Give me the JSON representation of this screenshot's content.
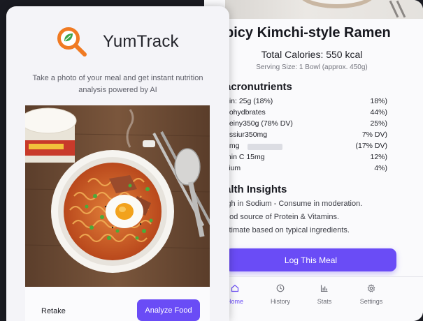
{
  "app": {
    "brand": "YumTrack",
    "tagline": "Take a photo of your meal and get instant nutrition analysis powered by AI",
    "retake_label": "Retake",
    "analyze_label": "Analyze Food",
    "accent_color": "#6a4cf6",
    "logo_color": "#f07a22",
    "leaf_color": "#3aa54a"
  },
  "result": {
    "dish_title": "picy Kimchi-style Ramen",
    "total_calories": "Total Calories: 550 kcal",
    "serving_size": "Serving Size: 1 Bowl (approx. 450g)",
    "macros_heading": "acronutrients",
    "macros": [
      {
        "label": "ein: 25g (18%)",
        "value": "18%)"
      },
      {
        "label": "bohydbrates",
        "value": "44%)"
      },
      {
        "label": "beiny350g (78% DV)",
        "value": "25%)"
      },
      {
        "label": "assiur350mg",
        "value": "7% DV)"
      },
      {
        "label": "4mg",
        "value": "(17% DV)"
      },
      {
        "label": "min C 15mg",
        "value": "12%)"
      },
      {
        "label": "cium",
        "value": "4%)"
      }
    ],
    "insights_heading": "alth Insights",
    "insights": [
      "igh in Sodium - Consume in moderation.",
      "ood source of Protein & Vitamins.",
      "stimate based on typical ingredients."
    ],
    "log_label": "Log This Meal"
  },
  "nav": {
    "items": [
      {
        "label": "Home",
        "icon": "home-icon",
        "active": true
      },
      {
        "label": "History",
        "icon": "clock-icon",
        "active": false
      },
      {
        "label": "Stats",
        "icon": "bar-chart-icon",
        "active": false
      },
      {
        "label": "Settings",
        "icon": "gear-icon",
        "active": false
      }
    ]
  }
}
